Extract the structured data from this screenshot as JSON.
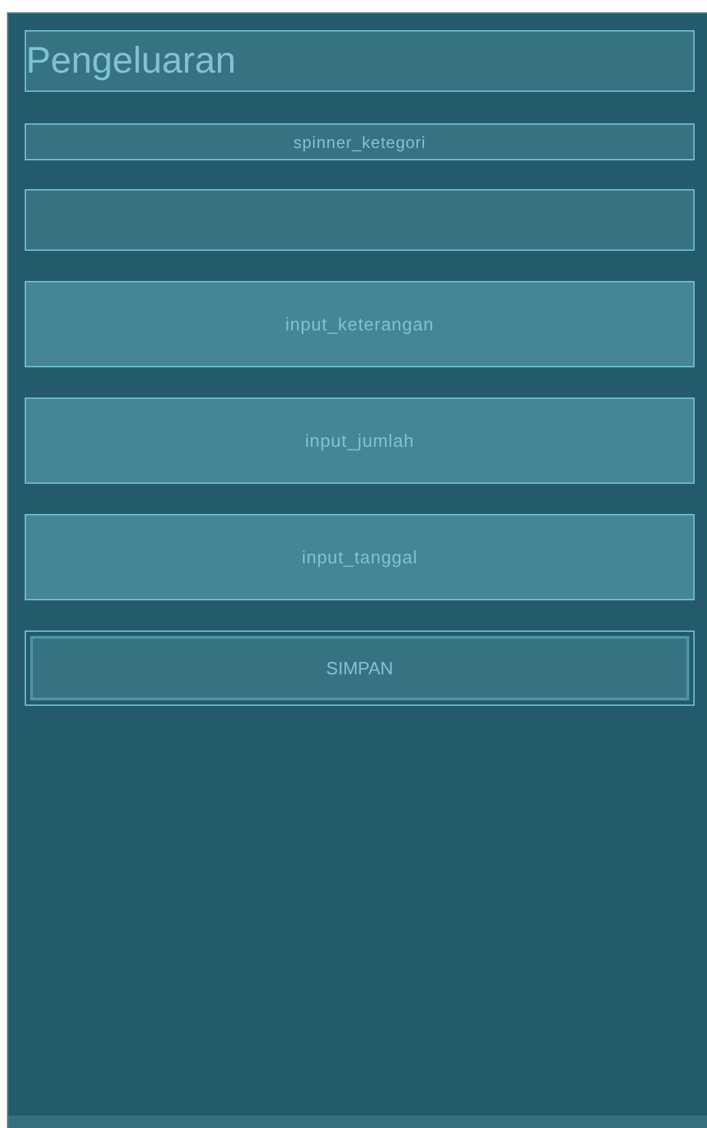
{
  "title": "Pengeluaran",
  "spinner": {
    "label": "spinner_ketegori"
  },
  "fields": [
    {
      "kind": "blank"
    },
    {
      "kind": "input",
      "label": "input_keterangan"
    },
    {
      "kind": "input",
      "label": "input_jumlah"
    },
    {
      "kind": "input",
      "label": "input_tanggal"
    }
  ],
  "button": {
    "label": "SIMPAN"
  }
}
